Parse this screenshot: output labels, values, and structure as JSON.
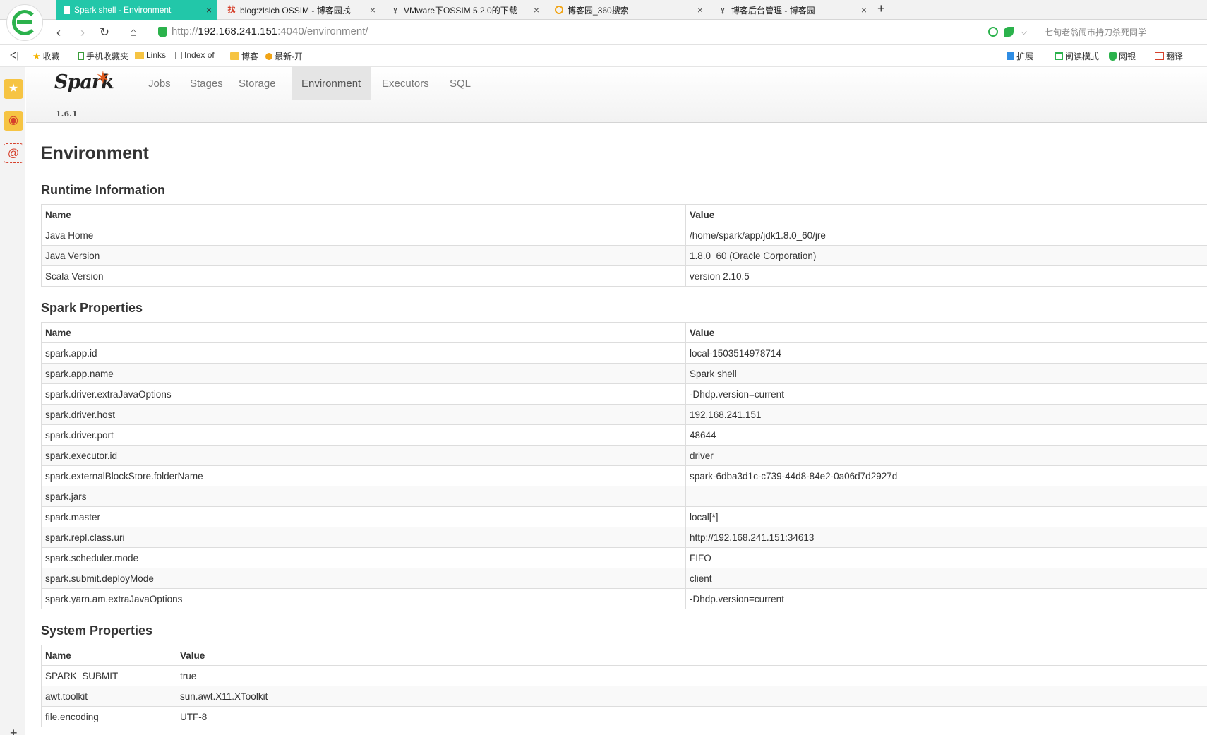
{
  "browser": {
    "tabs": [
      {
        "title": "Spark shell - Environment",
        "active": true,
        "icon": "page-icon"
      },
      {
        "title": "blog:zlslch OSSIM - 博客园找",
        "active": false,
        "icon": "cnblogs-find-icon"
      },
      {
        "title": "VMware下OSSIM 5.2.0的下载",
        "active": false,
        "icon": "cnblogs-icon"
      },
      {
        "title": "博客园_360搜索",
        "active": false,
        "icon": "360-search-icon"
      },
      {
        "title": "博客后台管理 - 博客园",
        "active": false,
        "icon": "cnblogs-icon"
      }
    ],
    "new_tab": "+",
    "close_glyph": "×",
    "url_prefix": "http://",
    "url_host": "192.168.241.151",
    "url_rest": ":4040/environment/",
    "address_right_text": "七旬老翁闹市持刀杀死同学",
    "bookmarks_left": [
      "收藏",
      "手机收藏夹",
      "Links",
      "Index of",
      "博客",
      "最新-开"
    ],
    "bookmarks_right": [
      "扩展",
      "阅读模式",
      "网银",
      "翻译"
    ]
  },
  "spark": {
    "brand": "Spark",
    "version": "1.6.1",
    "nav": [
      "Jobs",
      "Stages",
      "Storage",
      "Environment",
      "Executors",
      "SQL"
    ],
    "active_nav": "Environment",
    "accent_color": "#e25a1c"
  },
  "page": {
    "title": "Environment",
    "runtime": {
      "heading": "Runtime Information",
      "headers": [
        "Name",
        "Value"
      ],
      "rows": [
        [
          "Java Home",
          "/home/spark/app/jdk1.8.0_60/jre"
        ],
        [
          "Java Version",
          "1.8.0_60 (Oracle Corporation)"
        ],
        [
          "Scala Version",
          "version 2.10.5"
        ]
      ]
    },
    "spark_props": {
      "heading": "Spark Properties",
      "headers": [
        "Name",
        "Value"
      ],
      "rows": [
        [
          "spark.app.id",
          "local-1503514978714"
        ],
        [
          "spark.app.name",
          "Spark shell"
        ],
        [
          "spark.driver.extraJavaOptions",
          "-Dhdp.version=current"
        ],
        [
          "spark.driver.host",
          "192.168.241.151"
        ],
        [
          "spark.driver.port",
          "48644"
        ],
        [
          "spark.executor.id",
          "driver"
        ],
        [
          "spark.externalBlockStore.folderName",
          "spark-6dba3d1c-c739-44d8-84e2-0a06d7d2927d"
        ],
        [
          "spark.jars",
          ""
        ],
        [
          "spark.master",
          "local[*]"
        ],
        [
          "spark.repl.class.uri",
          "http://192.168.241.151:34613"
        ],
        [
          "spark.scheduler.mode",
          "FIFO"
        ],
        [
          "spark.submit.deployMode",
          "client"
        ],
        [
          "spark.yarn.am.extraJavaOptions",
          "-Dhdp.version=current"
        ]
      ]
    },
    "system_props": {
      "heading": "System Properties",
      "headers": [
        "Name",
        "Value"
      ],
      "rows": [
        [
          "SPARK_SUBMIT",
          "true"
        ],
        [
          "awt.toolkit",
          "sun.awt.X11.XToolkit"
        ],
        [
          "file.encoding",
          "UTF-8"
        ]
      ]
    }
  }
}
